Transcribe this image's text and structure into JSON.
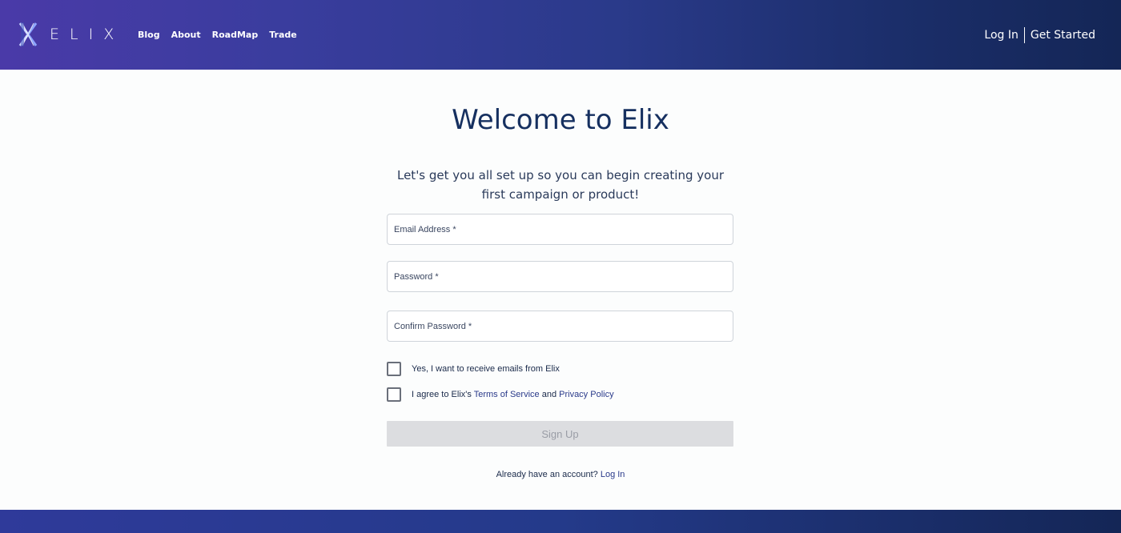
{
  "brand": {
    "name": "ELIX",
    "logo_icon": "elix-logo-icon"
  },
  "nav": {
    "items": [
      "Blog",
      "About",
      "RoadMap",
      "Trade"
    ]
  },
  "auth": {
    "login_label": "Log In",
    "get_started_label": "Get Started"
  },
  "main": {
    "title": "Welcome to Elix",
    "subtitle": "Let's get you all set up so you can begin creating your first campaign or product!"
  },
  "form": {
    "email_placeholder": "Email Address *",
    "password_placeholder": "Password *",
    "confirm_password_placeholder": "Confirm Password *",
    "email_opt_in_label": "Yes, I want to receive emails from Elix",
    "agree_prefix": "I agree to Elix's",
    "terms_label": "Terms of Service",
    "and_label": "and",
    "privacy_label": "Privacy Policy",
    "email_opt_in_checked": false,
    "agree_checked": false,
    "signup_label": "Sign Up"
  },
  "footer": {
    "account_prompt": "Already have an account?",
    "login_link": "Log In"
  },
  "colors": {
    "header_start": "#4a3aa8",
    "header_end": "#142656",
    "title": "#163060",
    "button_disabled": "#dcdde0"
  }
}
